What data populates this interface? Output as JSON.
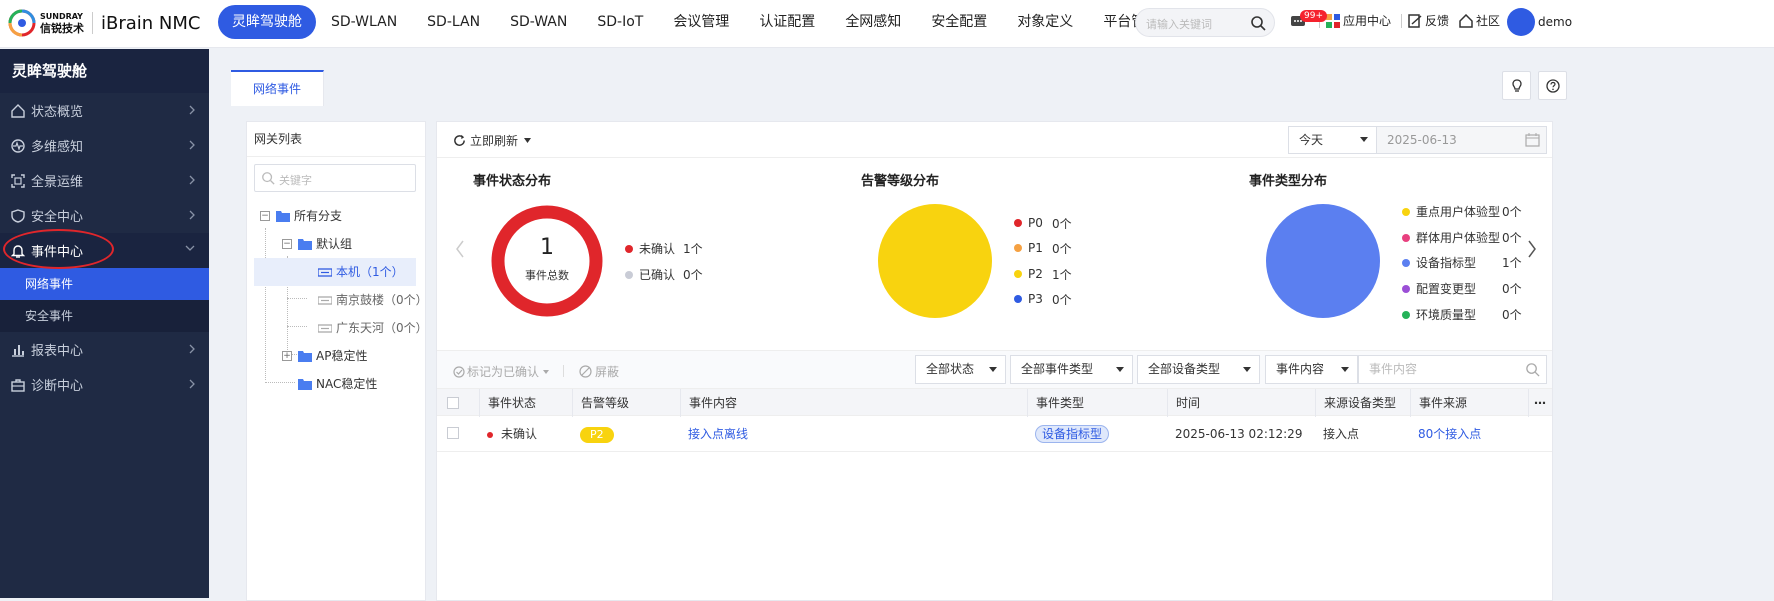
{
  "brand": {
    "logo_en": "SUNDRAY",
    "logo_cn": "信锐技术",
    "title": "iBrain NMC"
  },
  "topnav": [
    {
      "label": "灵眸驾驶舱",
      "active": true
    },
    {
      "label": "SD-WLAN"
    },
    {
      "label": "SD-LAN"
    },
    {
      "label": "SD-WAN"
    },
    {
      "label": "SD-IoT"
    },
    {
      "label": "会议管理"
    },
    {
      "label": "认证配置"
    },
    {
      "label": "全网感知"
    },
    {
      "label": "安全配置"
    },
    {
      "label": "对象定义"
    },
    {
      "label": "平台管理"
    }
  ],
  "search": {
    "placeholder": "请输入关键词"
  },
  "header_right": {
    "badge": "99+",
    "app_center": "应用中心",
    "feedback": "反馈",
    "community": "社区",
    "user": "demo"
  },
  "sidebar": {
    "title": "灵眸驾驶舱",
    "items": [
      {
        "label": "状态概览"
      },
      {
        "label": "多维感知"
      },
      {
        "label": "全景运维"
      },
      {
        "label": "安全中心"
      },
      {
        "label": "事件中心",
        "open": true
      },
      {
        "label": "报表中心"
      },
      {
        "label": "诊断中心"
      }
    ],
    "sub_items": [
      {
        "label": "网络事件",
        "active": true
      },
      {
        "label": "安全事件"
      }
    ]
  },
  "tab": {
    "label": "网络事件"
  },
  "gateway": {
    "title": "网关列表",
    "keyword_placeholder": "关键字",
    "tree": {
      "root": "所有分支",
      "group": "默认组",
      "local": "本机（1个）",
      "dev1": "南京鼓楼（0个）",
      "dev2": "广东天河（0个）",
      "ap": "AP稳定性",
      "nac": "NAC稳定性"
    }
  },
  "toolbar": {
    "refresh": "立即刷新",
    "range": "今天",
    "date": "2025-06-13"
  },
  "stats": {
    "status": {
      "title": "事件状态分布",
      "total": "1",
      "total_label": "事件总数",
      "legend": [
        {
          "label": "未确认",
          "count": "1个",
          "color": "#e0262b"
        },
        {
          "label": "已确认",
          "count": "0个",
          "color": "#c9ccd6"
        }
      ]
    },
    "level": {
      "title": "告警等级分布",
      "legend": [
        {
          "label": "P0",
          "count": "0个",
          "color": "#e0262b"
        },
        {
          "label": "P1",
          "count": "0个",
          "color": "#f5a142"
        },
        {
          "label": "P2",
          "count": "1个",
          "color": "#f8d30f"
        },
        {
          "label": "P3",
          "count": "0个",
          "color": "#2f5be2"
        }
      ]
    },
    "type": {
      "title": "事件类型分布",
      "legend": [
        {
          "label": "重点用户体验型",
          "count": "0个",
          "color": "#f8d30f"
        },
        {
          "label": "群体用户体验型",
          "count": "0个",
          "color": "#e8407f"
        },
        {
          "label": "设备指标型",
          "count": "1个",
          "color": "#5b7ff0"
        },
        {
          "label": "配置变更型",
          "count": "0个",
          "color": "#9b4fd6"
        },
        {
          "label": "环境质量型",
          "count": "0个",
          "color": "#25b259"
        }
      ]
    }
  },
  "filters": {
    "mark": "标记为已确认",
    "mask": "屏蔽",
    "status": "全部状态",
    "event_type": "全部事件类型",
    "device_type": "全部设备类型",
    "field": "事件内容",
    "search_placeholder": "事件内容"
  },
  "table": {
    "columns": [
      "事件状态",
      "告警等级",
      "事件内容",
      "事件类型",
      "时间",
      "来源设备类型",
      "事件来源"
    ],
    "rows": [
      {
        "status": "未确认",
        "level": "P2",
        "content": "接入点离线",
        "type": "设备指标型",
        "time": "2025-06-13 02:12:29",
        "device_type": "接入点",
        "source": "80个接入点"
      }
    ]
  }
}
